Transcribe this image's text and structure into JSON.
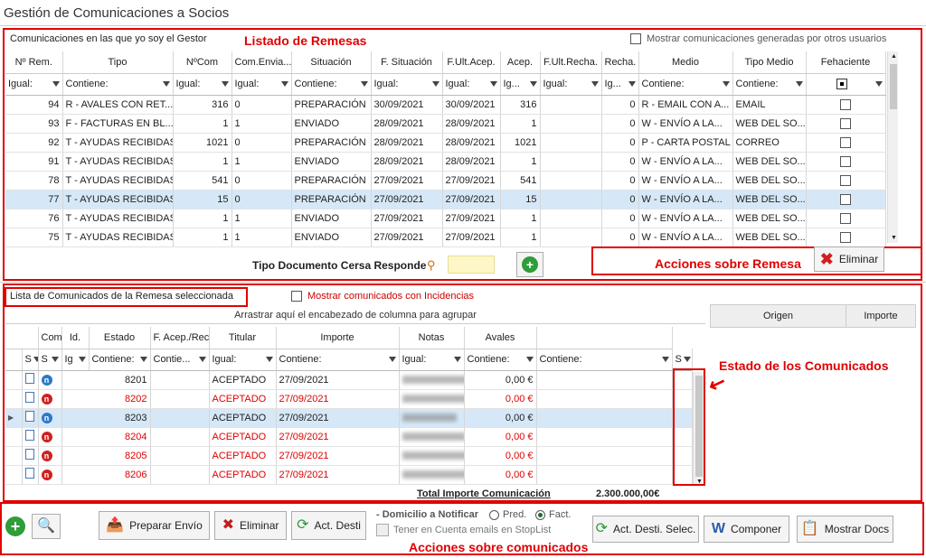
{
  "window_title": "Gestión de Comunicaciones a Socios",
  "top": {
    "section_label": "Comunicaciones en las que yo soy el Gestor",
    "annotation_listado": "Listado de Remesas",
    "show_others_label": "Mostrar comunicaciones generadas por otros usuarios",
    "columns": [
      "Nº Rem.",
      "Tipo",
      "NºCom",
      "Com.Envia...",
      "Situación",
      "F. Situación",
      "F.Ult.Acep.",
      "Acep.",
      "F.Ult.Recha.",
      "Recha.",
      "Medio",
      "Tipo Medio",
      "Fehaciente"
    ],
    "filters": [
      "Igual:",
      "Contiene:",
      "Igual:",
      "Igual:",
      "Contiene:",
      "Igual:",
      "Igual:",
      "Ig...",
      "Igual:",
      "Ig...",
      "Contiene:",
      "Contiene:",
      ""
    ],
    "rows": [
      [
        "94",
        "R - AVALES CON RET...",
        "316",
        "0",
        "PREPARACIÓN",
        "30/09/2021",
        "30/09/2021",
        "316",
        "",
        "0",
        "R - EMAIL CON A...",
        "EMAIL"
      ],
      [
        "93",
        "F - FACTURAS EN BL...",
        "1",
        "1",
        "ENVIADO",
        "28/09/2021",
        "28/09/2021",
        "1",
        "",
        "0",
        "W - ENVÍO A LA...",
        "WEB DEL SO..."
      ],
      [
        "92",
        "T - AYUDAS RECIBIDAS",
        "1021",
        "0",
        "PREPARACIÓN",
        "28/09/2021",
        "28/09/2021",
        "1021",
        "",
        "0",
        "P - CARTA POSTAL",
        "CORREO"
      ],
      [
        "91",
        "T - AYUDAS RECIBIDAS",
        "1",
        "1",
        "ENVIADO",
        "28/09/2021",
        "28/09/2021",
        "1",
        "",
        "0",
        "W - ENVÍO A LA...",
        "WEB DEL SO..."
      ],
      [
        "78",
        "T - AYUDAS RECIBIDAS",
        "541",
        "0",
        "PREPARACIÓN",
        "27/09/2021",
        "27/09/2021",
        "541",
        "",
        "0",
        "W - ENVÍO A LA...",
        "WEB DEL SO..."
      ],
      [
        "77",
        "T - AYUDAS RECIBIDAS",
        "15",
        "0",
        "PREPARACIÓN",
        "27/09/2021",
        "27/09/2021",
        "15",
        "",
        "0",
        "W - ENVÍO A LA...",
        "WEB DEL SO..."
      ],
      [
        "76",
        "T - AYUDAS RECIBIDAS",
        "1",
        "1",
        "ENVIADO",
        "27/09/2021",
        "27/09/2021",
        "1",
        "",
        "0",
        "W - ENVÍO A LA...",
        "WEB DEL SO..."
      ],
      [
        "75",
        "T - AYUDAS RECIBIDAS",
        "1",
        "1",
        "ENVIADO",
        "27/09/2021",
        "27/09/2021",
        "1",
        "",
        "0",
        "W - ENVÍO A LA...",
        "WEB DEL SO..."
      ]
    ],
    "selected_row": 5,
    "tipo_doc_label": "Tipo Documento Cersa Responde",
    "acciones_remesa": "Acciones sobre Remesa",
    "eliminar": "Eliminar"
  },
  "bottom": {
    "section_label": "Lista de Comunicados de la Remesa seleccionada",
    "incidencias_label": "Mostrar comunicados con Incidencias",
    "group_hint": "Arrastrar aquí el encabezado de columna para agrupar",
    "origen": "Origen",
    "importe_header": "Importe",
    "estado_annotation": "Estado de los Comunicados",
    "columns": [
      "",
      "",
      "Com.",
      "Id.",
      "Estado",
      "F. Acep./Rech.",
      "Titular",
      "Importe",
      "Notas",
      "Avales",
      ""
    ],
    "filters": [
      "S",
      "S",
      "Ig",
      "Contiene:",
      "Contie...",
      "Igual:",
      "Contiene:",
      "Igual:",
      "Contiene:",
      "Contiene:",
      "S"
    ],
    "rows": [
      {
        "com": "8201",
        "estado": "ACEPTADO",
        "fecha": "27/09/2021",
        "importe": "0,00 €",
        "red": false
      },
      {
        "com": "8202",
        "estado": "ACEPTADO",
        "fecha": "27/09/2021",
        "importe": "0,00 €",
        "red": true
      },
      {
        "com": "8203",
        "estado": "ACEPTADO",
        "fecha": "27/09/2021",
        "importe": "0,00 €",
        "red": false
      },
      {
        "com": "8204",
        "estado": "ACEPTADO",
        "fecha": "27/09/2021",
        "importe": "0,00 €",
        "red": true
      },
      {
        "com": "8205",
        "estado": "ACEPTADO",
        "fecha": "27/09/2021",
        "importe": "0,00 €",
        "red": true
      },
      {
        "com": "8206",
        "estado": "ACEPTADO",
        "fecha": "27/09/2021",
        "importe": "0,00 €",
        "red": true
      }
    ],
    "selected_row": 2,
    "total_label": "Total Importe Comunicación",
    "total_value": "2.300.000,00€"
  },
  "actions": {
    "preparar": "Preparar Envío",
    "eliminar": "Eliminar",
    "act_desti": "Act. Desti",
    "domicilio": "- Domicilio a Notificar",
    "pred": "Pred.",
    "fact": "Fact.",
    "stoplist": "Tener en Cuenta emails en StopList",
    "act_desti_selec": "Act. Desti. Selec.",
    "componer": "Componer",
    "mostrar_docs": "Mostrar Docs",
    "annotation": "Acciones sobre comunicados"
  }
}
